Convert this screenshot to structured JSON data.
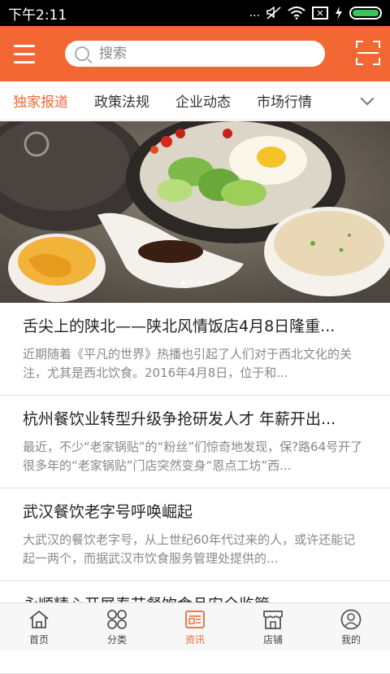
{
  "status": {
    "time": "下午2:11",
    "dots": "...",
    "x_glyph": "✕"
  },
  "search": {
    "placeholder": "搜索"
  },
  "tabs": [
    "独家报道",
    "政策法规",
    "企业动态",
    "市场行情"
  ],
  "banner": {
    "dot_count": 4,
    "active_dot": 0
  },
  "news": [
    {
      "title": "舌尖上的陕北——陕北风情饭店4月8日隆重...",
      "desc": "近期随着《平凡的世界》热播也引起了人们对于西北文化的关注，尤其是西北饮食。2016年4月8日，位于和..."
    },
    {
      "title": "杭州餐饮业转型升级争抢研发人才 年薪开出...",
      "desc": "最近，不少“老家锅贴”的“粉丝”们惊奇地发现，保?路64号开了很多年的“老家锅贴”门店突然变身“恩点工坊”西..."
    },
    {
      "title": "武汉餐饮老字号呼唤崛起",
      "desc": "大武汉的餐饮老字号，从上世纪60年代过来的人，或许还能记起一两个，而据武汉市饮食服务管理处提供的..."
    },
    {
      "title": "永顺精心开展春节餐饮食品安全监管",
      "desc": ""
    }
  ],
  "bottom_nav": [
    {
      "label": "首页",
      "icon": "home-icon"
    },
    {
      "label": "分类",
      "icon": "category-icon"
    },
    {
      "label": "资讯",
      "icon": "news-icon"
    },
    {
      "label": "店铺",
      "icon": "store-icon"
    },
    {
      "label": "我的",
      "icon": "profile-icon"
    }
  ],
  "colors": {
    "accent": "#f26733"
  }
}
